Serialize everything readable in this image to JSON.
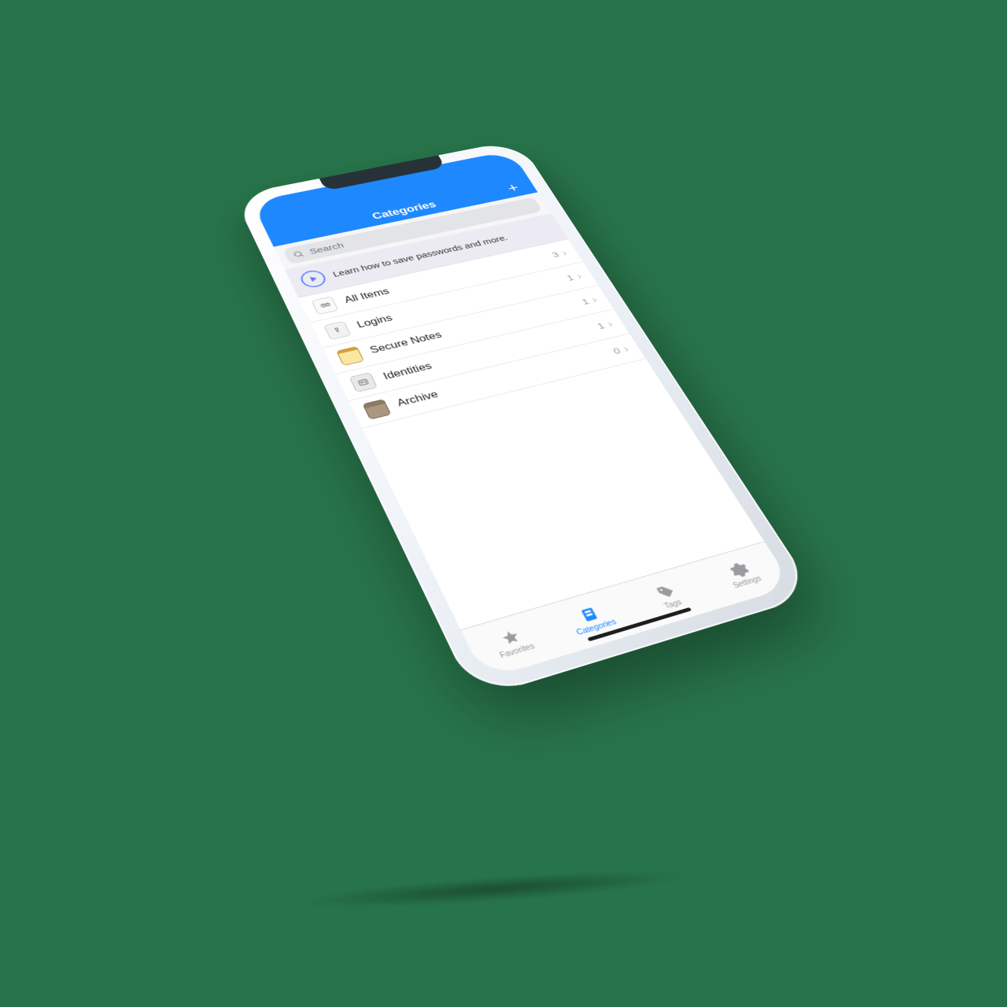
{
  "header": {
    "title": "Categories"
  },
  "search": {
    "placeholder": "Search"
  },
  "hint": {
    "text": "Learn how to save passwords and more."
  },
  "categories": [
    {
      "label": "All Items",
      "count": "3"
    },
    {
      "label": "Logins",
      "count": "1"
    },
    {
      "label": "Secure Notes",
      "count": "1"
    },
    {
      "label": "Identities",
      "count": "1"
    },
    {
      "label": "Archive",
      "count": "0"
    }
  ],
  "tabs": [
    {
      "label": "Favorites"
    },
    {
      "label": "Categories"
    },
    {
      "label": "Tags"
    },
    {
      "label": "Settings"
    }
  ]
}
